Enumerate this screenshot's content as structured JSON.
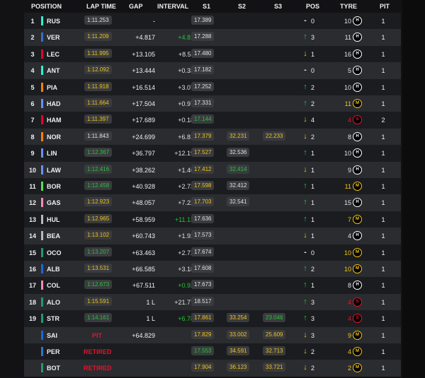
{
  "header": {
    "position": "POSITION",
    "lap_time": "LAP TIME",
    "gap": "GAP",
    "interval": "INTERVAL",
    "s1": "S1",
    "s2": "S2",
    "s3": "S3",
    "pos": "POS",
    "tyre": "TYRE",
    "pit": "PIT"
  },
  "colors": {
    "background": "#121214",
    "row_even": "#1b1c1f",
    "row_odd": "#2b2c30",
    "pill": "#3a3b3f",
    "green": "#29c23d",
    "yellow": "#f0c419",
    "red": "#e8112d"
  },
  "tyre_compounds": {
    "H": {
      "label": "H",
      "color": "#ffffff"
    },
    "M": {
      "label": "M",
      "color": "#f0c419"
    },
    "S": {
      "label": "S",
      "color": "#e8112d"
    }
  },
  "rows": [
    {
      "pos": "1",
      "team_color": "#27f4d2",
      "driver": "RUS",
      "lap": "1:11.253",
      "lap_color": "white",
      "gap": "-",
      "interval": "-",
      "interval_color": "white",
      "s1": "17.389",
      "s1_color": "white",
      "s2": "",
      "s2_color": "white",
      "s3": "",
      "s3_color": "white",
      "arrow": "-",
      "arrow_color": "white",
      "pos_change": "0",
      "laps": "10",
      "tyre": "H",
      "pits": "1"
    },
    {
      "pos": "2",
      "team_color": "#3671c6",
      "driver": "VER",
      "lap": "1:11.209",
      "lap_color": "yellow",
      "gap": "+4.817",
      "interval": "+4.817",
      "interval_color": "green",
      "s1": "17.288",
      "s1_color": "white",
      "s2": "",
      "s2_color": "white",
      "s3": "",
      "s3_color": "white",
      "arrow": "↑",
      "arrow_color": "green",
      "pos_change": "3",
      "laps": "11",
      "tyre": "H",
      "pits": "1"
    },
    {
      "pos": "3",
      "team_color": "#e8002d",
      "driver": "LEC",
      "lap": "1:11.995",
      "lap_color": "yellow",
      "gap": "+13.105",
      "interval": "+8.511",
      "interval_color": "white",
      "s1": "17.480",
      "s1_color": "white",
      "s2": "",
      "s2_color": "white",
      "s3": "",
      "s3_color": "white",
      "arrow": "↓",
      "arrow_color": "yellow",
      "pos_change": "1",
      "laps": "16",
      "tyre": "H",
      "pits": "1"
    },
    {
      "pos": "4",
      "team_color": "#27f4d2",
      "driver": "ANT",
      "lap": "1:12.092",
      "lap_color": "yellow",
      "gap": "+13.444",
      "interval": "+0.339",
      "interval_color": "white",
      "s1": "17.182",
      "s1_color": "white",
      "s2": "",
      "s2_color": "white",
      "s3": "",
      "s3_color": "white",
      "arrow": "-",
      "arrow_color": "white",
      "pos_change": "0",
      "laps": "5",
      "tyre": "H",
      "pits": "1"
    },
    {
      "pos": "5",
      "team_color": "#ff8000",
      "driver": "PIA",
      "lap": "1:11.918",
      "lap_color": "yellow",
      "gap": "+16.514",
      "interval": "+3.070",
      "interval_color": "white",
      "s1": "17.252",
      "s1_color": "white",
      "s2": "",
      "s2_color": "white",
      "s3": "",
      "s3_color": "white",
      "arrow": "↑",
      "arrow_color": "green",
      "pos_change": "2",
      "laps": "10",
      "tyre": "H",
      "pits": "1"
    },
    {
      "pos": "6",
      "team_color": "#6692ff",
      "driver": "HAD",
      "lap": "1:11.664",
      "lap_color": "yellow",
      "gap": "+17.504",
      "interval": "+0.975",
      "interval_color": "white",
      "s1": "17.331",
      "s1_color": "white",
      "s2": "",
      "s2_color": "white",
      "s3": "",
      "s3_color": "white",
      "arrow": "↑",
      "arrow_color": "green",
      "pos_change": "2",
      "laps": "11",
      "tyre": "M",
      "pits": "1"
    },
    {
      "pos": "7",
      "team_color": "#e8002d",
      "driver": "HAM",
      "lap": "1:11.397",
      "lap_color": "yellow",
      "gap": "+17.689",
      "interval": "+0.185",
      "interval_color": "white",
      "s1": "17.144",
      "s1_color": "green",
      "s2": "",
      "s2_color": "white",
      "s3": "",
      "s3_color": "white",
      "arrow": "↓",
      "arrow_color": "yellow",
      "pos_change": "4",
      "laps": "4",
      "tyre": "S",
      "pits": "2"
    },
    {
      "pos": "8",
      "team_color": "#ff8000",
      "driver": "NOR",
      "lap": "1:11.843",
      "lap_color": "white",
      "gap": "+24.699",
      "interval": "+6.812",
      "interval_color": "white",
      "s1": "17.379",
      "s1_color": "yellow",
      "s2": "32.231",
      "s2_color": "yellow",
      "s3": "22.233",
      "s3_color": "yellow",
      "arrow": "↓",
      "arrow_color": "yellow",
      "pos_change": "2",
      "laps": "8",
      "tyre": "H",
      "pits": "1"
    },
    {
      "pos": "9",
      "team_color": "#6692ff",
      "driver": "LIN",
      "lap": "1:12.367",
      "lap_color": "green",
      "gap": "+36.797",
      "interval": "+12.193",
      "interval_color": "white",
      "s1": "17.527",
      "s1_color": "yellow",
      "s2": "32.536",
      "s2_color": "white",
      "s3": "",
      "s3_color": "white",
      "arrow": "↑",
      "arrow_color": "green",
      "pos_change": "1",
      "laps": "10",
      "tyre": "H",
      "pits": "1"
    },
    {
      "pos": "10",
      "team_color": "#6692ff",
      "driver": "LAW",
      "lap": "1:12.416",
      "lap_color": "green",
      "gap": "+38.262",
      "interval": "+1.461",
      "interval_color": "white",
      "s1": "17.412",
      "s1_color": "yellow",
      "s2": "32.414",
      "s2_color": "green",
      "s3": "",
      "s3_color": "white",
      "arrow": "↓",
      "arrow_color": "yellow",
      "pos_change": "1",
      "laps": "9",
      "tyre": "H",
      "pits": "1"
    },
    {
      "pos": "11",
      "team_color": "#52e252",
      "driver": "BOR",
      "lap": "1:12.458",
      "lap_color": "green",
      "gap": "+40.928",
      "interval": "+2.739",
      "interval_color": "white",
      "s1": "17.598",
      "s1_color": "yellow",
      "s2": "32.412",
      "s2_color": "white",
      "s3": "",
      "s3_color": "white",
      "arrow": "↑",
      "arrow_color": "green",
      "pos_change": "1",
      "laps": "11",
      "tyre": "M",
      "pits": "1"
    },
    {
      "pos": "12",
      "team_color": "#ff87bc",
      "driver": "GAS",
      "lap": "1:12.923",
      "lap_color": "yellow",
      "gap": "+48.057",
      "interval": "+7.229",
      "interval_color": "white",
      "s1": "17.703",
      "s1_color": "yellow",
      "s2": "32.541",
      "s2_color": "white",
      "s3": "",
      "s3_color": "white",
      "arrow": "↑",
      "arrow_color": "green",
      "pos_change": "1",
      "laps": "15",
      "tyre": "H",
      "pits": "1"
    },
    {
      "pos": "13",
      "team_color": "#b6babd",
      "driver": "HUL",
      "lap": "1:12.965",
      "lap_color": "yellow",
      "gap": "+58.959",
      "interval": "+11.131",
      "interval_color": "green",
      "s1": "17.636",
      "s1_color": "white",
      "s2": "",
      "s2_color": "white",
      "s3": "",
      "s3_color": "white",
      "arrow": "↑",
      "arrow_color": "green",
      "pos_change": "1",
      "laps": "7",
      "tyre": "M",
      "pits": "1"
    },
    {
      "pos": "14",
      "team_color": "#b6babd",
      "driver": "BEA",
      "lap": "1:13.102",
      "lap_color": "yellow",
      "gap": "+60.743",
      "interval": "+1.926",
      "interval_color": "white",
      "s1": "17.573",
      "s1_color": "white",
      "s2": "",
      "s2_color": "white",
      "s3": "",
      "s3_color": "white",
      "arrow": "↓",
      "arrow_color": "yellow",
      "pos_change": "1",
      "laps": "4",
      "tyre": "H",
      "pits": "1"
    },
    {
      "pos": "15",
      "team_color": "#229971",
      "driver": "OCO",
      "lap": "1:13.207",
      "lap_color": "green",
      "gap": "+63.463",
      "interval": "+2.720",
      "interval_color": "white",
      "s1": "17.674",
      "s1_color": "white",
      "s2": "",
      "s2_color": "white",
      "s3": "",
      "s3_color": "white",
      "arrow": "-",
      "arrow_color": "white",
      "pos_change": "0",
      "laps": "10",
      "tyre": "M",
      "pits": "1"
    },
    {
      "pos": "16",
      "team_color": "#1868db",
      "driver": "ALB",
      "lap": "1:13.531",
      "lap_color": "yellow",
      "gap": "+66.585",
      "interval": "+3.181",
      "interval_color": "white",
      "s1": "17.608",
      "s1_color": "white",
      "s2": "",
      "s2_color": "white",
      "s3": "",
      "s3_color": "white",
      "arrow": "↑",
      "arrow_color": "green",
      "pos_change": "2",
      "laps": "10",
      "tyre": "M",
      "pits": "1"
    },
    {
      "pos": "17",
      "team_color": "#ff87bc",
      "driver": "COL",
      "lap": "1:12.673",
      "lap_color": "green",
      "gap": "+67.511",
      "interval": "+0.926",
      "interval_color": "green",
      "s1": "17.673",
      "s1_color": "white",
      "s2": "",
      "s2_color": "white",
      "s3": "",
      "s3_color": "white",
      "arrow": "↑",
      "arrow_color": "green",
      "pos_change": "1",
      "laps": "8",
      "tyre": "H",
      "pits": "1"
    },
    {
      "pos": "18",
      "team_color": "#229971",
      "driver": "ALO",
      "lap": "1:15.591",
      "lap_color": "yellow",
      "gap": "1 L",
      "interval": "+21.774",
      "interval_color": "white",
      "s1": "18.517",
      "s1_color": "white",
      "s2": "",
      "s2_color": "white",
      "s3": "",
      "s3_color": "white",
      "arrow": "↑",
      "arrow_color": "green",
      "pos_change": "3",
      "laps": "4",
      "tyre": "S",
      "pits": "1"
    },
    {
      "pos": "19",
      "team_color": "#229971",
      "driver": "STR",
      "lap": "1:14.161",
      "lap_color": "green",
      "gap": "1 L",
      "interval": "+6.783",
      "interval_color": "green",
      "s1": "17.861",
      "s1_color": "yellow",
      "s2": "33.254",
      "s2_color": "yellow",
      "s3": "23.046",
      "s3_color": "green",
      "arrow": "↑",
      "arrow_color": "green",
      "pos_change": "3",
      "laps": "4",
      "tyre": "S",
      "pits": "1"
    },
    {
      "pos": "",
      "team_color": "#1868db",
      "driver": "SAI",
      "lap": "PIT",
      "lap_color": "red",
      "gap": "+64.829",
      "interval": "",
      "interval_color": "white",
      "s1": "17.829",
      "s1_color": "yellow",
      "s2": "33.002",
      "s2_color": "yellow",
      "s3": "25.609",
      "s3_color": "yellow",
      "arrow": "↓",
      "arrow_color": "yellow",
      "pos_change": "3",
      "laps": "9",
      "tyre": "M",
      "pits": "1"
    },
    {
      "pos": "",
      "team_color": "#3671c6",
      "driver": "PER",
      "lap": "RETIRED",
      "lap_color": "red",
      "gap": "",
      "interval": "",
      "interval_color": "white",
      "s1": "17.553",
      "s1_color": "green",
      "s2": "34.591",
      "s2_color": "yellow",
      "s3": "32.713",
      "s3_color": "yellow",
      "arrow": "↓",
      "arrow_color": "yellow",
      "pos_change": "2",
      "laps": "4",
      "tyre": "M",
      "pits": "1"
    },
    {
      "pos": "",
      "team_color": "#229971",
      "driver": "BOT",
      "lap": "RETIRED",
      "lap_color": "red",
      "gap": "",
      "interval": "",
      "interval_color": "white",
      "s1": "17.904",
      "s1_color": "yellow",
      "s2": "36.123",
      "s2_color": "yellow",
      "s3": "33.721",
      "s3_color": "yellow",
      "arrow": "↓",
      "arrow_color": "yellow",
      "pos_change": "2",
      "laps": "2",
      "tyre": "M",
      "pits": "1"
    }
  ]
}
